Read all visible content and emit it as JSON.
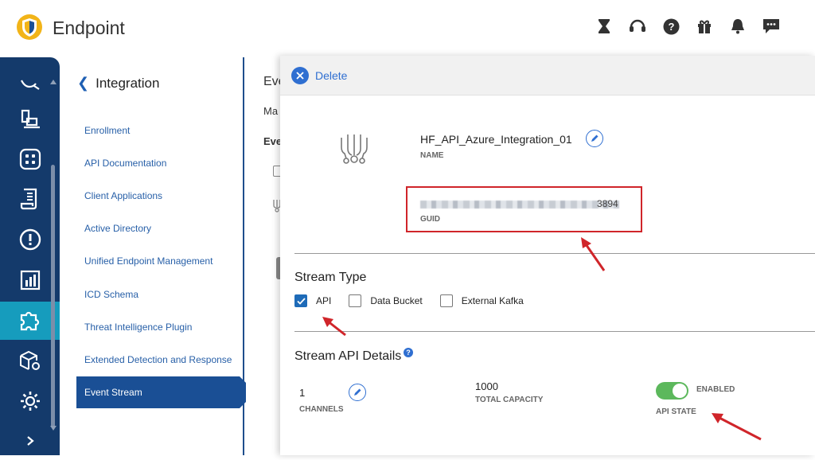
{
  "app": {
    "title": "Endpoint"
  },
  "subnav": {
    "title": "Integration",
    "items": [
      "Enrollment",
      "API Documentation",
      "Client Applications",
      "Active Directory",
      "Unified Endpoint Management",
      "ICD Schema",
      "Threat Intelligence Plugin",
      "Extended Detection and Response",
      "Event Stream"
    ],
    "active_index": 8
  },
  "behind": {
    "t1": "Eve",
    "t2": "Ma",
    "t3": "Eve"
  },
  "panel": {
    "delete_label": "Delete",
    "name_value": "HF_API_Azure_Integration_01",
    "name_label": "NAME",
    "guid_tail": "3894",
    "guid_label": "GUID",
    "stream_type_title": "Stream Type",
    "stream_types": [
      {
        "label": "API",
        "checked": true
      },
      {
        "label": "Data Bucket",
        "checked": false
      },
      {
        "label": "External Kafka",
        "checked": false
      }
    ],
    "api_details_title": "Stream API Details",
    "channels_value": "1",
    "channels_label": "CHANNELS",
    "capacity_value": "1000",
    "capacity_label": "TOTAL CAPACITY",
    "state_value": "ENABLED",
    "state_label": "API STATE"
  },
  "colors": {
    "rail": "#143a6b",
    "rail_active": "#169cbd",
    "accent": "#2f6fd1",
    "highlight_red": "#d0252a",
    "toggle_on": "#5cb85c"
  },
  "icons": {
    "top": [
      "hourglass-icon",
      "headset-icon",
      "help-icon",
      "gift-icon",
      "bell-icon",
      "chat-icon"
    ],
    "rail": [
      "search-icon",
      "devices-icon",
      "apps-icon",
      "policy-icon",
      "alert-icon",
      "reports-icon",
      "integration-icon",
      "package-icon",
      "settings-icon",
      "expand-icon"
    ]
  }
}
